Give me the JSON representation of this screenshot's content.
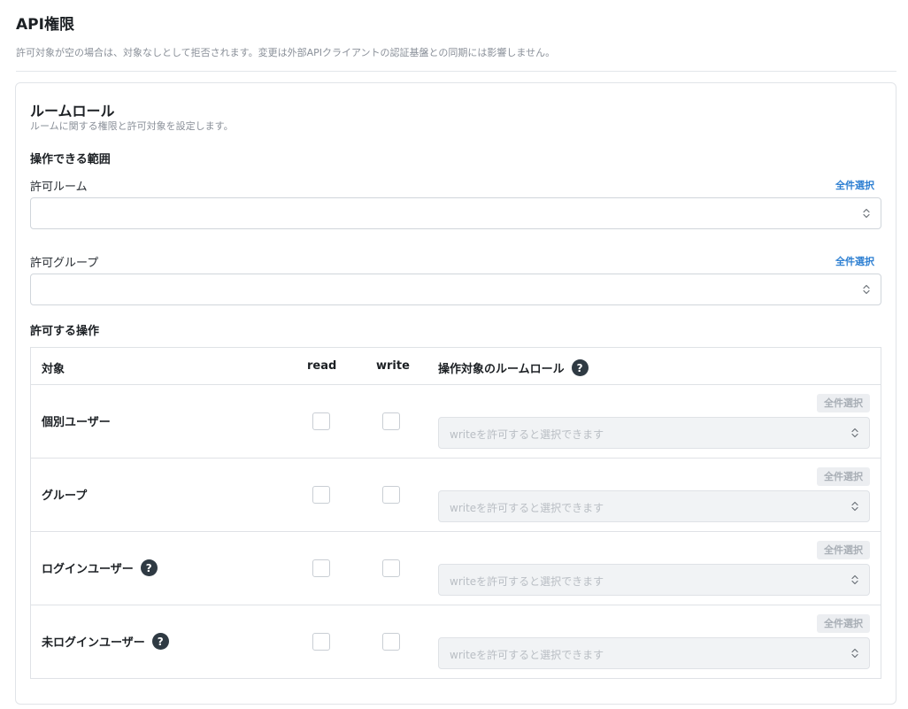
{
  "header": {
    "title": "API権限",
    "description": "許可対象が空の場合は、対象なしとして拒否されます。変更は外部APIクライアントの認証基盤との同期には影響しません。"
  },
  "card": {
    "title": "ルームロール",
    "description": "ルームに関する権限と許可対象を設定します。",
    "scope_section": "操作できる範囲",
    "allowed_rooms": {
      "label": "許可ルーム",
      "select_all": "全件選択",
      "value": ""
    },
    "allowed_groups": {
      "label": "許可グループ",
      "select_all": "全件選択",
      "value": ""
    },
    "operations_section": "許可する操作",
    "table": {
      "headers": {
        "target": "対象",
        "read": "read",
        "write": "write",
        "role": "操作対象のルームロール"
      },
      "rows": [
        {
          "label": "個別ユーザー",
          "help": false,
          "read": false,
          "write": false,
          "select_all": "全件選択",
          "placeholder": "writeを許可すると選択できます"
        },
        {
          "label": "グループ",
          "help": false,
          "read": false,
          "write": false,
          "select_all": "全件選択",
          "placeholder": "writeを許可すると選択できます"
        },
        {
          "label": "ログインユーザー",
          "help": true,
          "read": false,
          "write": false,
          "select_all": "全件選択",
          "placeholder": "writeを許可すると選択できます"
        },
        {
          "label": "未ログインユーザー",
          "help": true,
          "read": false,
          "write": false,
          "select_all": "全件選択",
          "placeholder": "writeを許可すると選択できます"
        }
      ]
    }
  },
  "icons": {
    "help": "?",
    "chevron": "chevron-updown-icon"
  },
  "colors": {
    "link": "#2d7fd2",
    "help_bg": "#2f3a43",
    "disabled_text": "#b9bec4"
  }
}
